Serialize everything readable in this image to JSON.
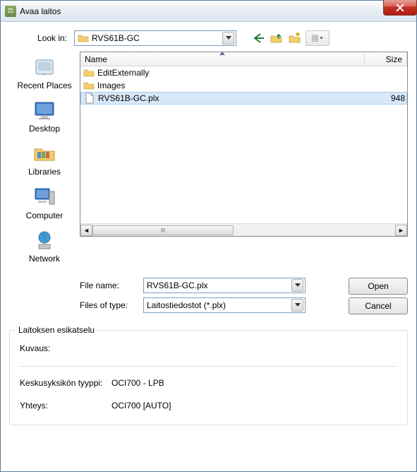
{
  "window": {
    "title": "Avaa laitos"
  },
  "lookin": {
    "label": "Look in:",
    "value": "RVS61B-GC"
  },
  "places": {
    "recent": "Recent Places",
    "desktop": "Desktop",
    "libraries": "Libraries",
    "computer": "Computer",
    "network": "Network"
  },
  "columns": {
    "name": "Name",
    "size": "Size"
  },
  "files": {
    "editext": {
      "name": "EditExternally",
      "size": ""
    },
    "images": {
      "name": "Images",
      "size": ""
    },
    "plx": {
      "name": "RVS61B-GC.plx",
      "size": "948"
    }
  },
  "filename": {
    "label": "File name:",
    "value": "RVS61B-GC.plx"
  },
  "filetype": {
    "label": "Files of type:",
    "value": "Laitostiedostot (*.plx)"
  },
  "buttons": {
    "open": "Open",
    "cancel": "Cancel"
  },
  "preview": {
    "legend": "Laitoksen esikatselu",
    "kuvaus_label": "Kuvaus:",
    "kuvaus_value": "",
    "cpu_label": "Keskusyksikön tyyppi:",
    "cpu_value": "OCI700 - LPB",
    "conn_label": "Yhteys:",
    "conn_value": "OCI700 [AUTO]"
  }
}
